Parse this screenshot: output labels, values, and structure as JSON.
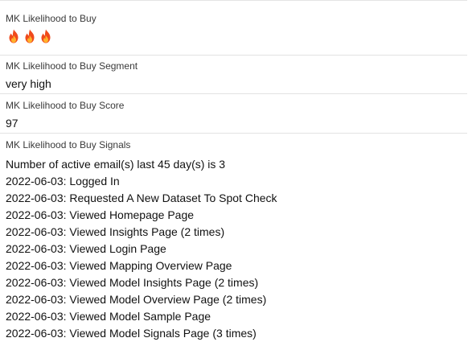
{
  "fields": {
    "likelihood": {
      "label": "MK Likelihood to Buy",
      "icon": "fire-icon",
      "icon_count": 3,
      "icon_color": "#f04a1c"
    },
    "segment": {
      "label": "MK Likelihood to Buy Segment",
      "value": "very high"
    },
    "score": {
      "label": "MK Likelihood to Buy Score",
      "value": "97"
    },
    "signals": {
      "label": "MK Likelihood to Buy Signals",
      "lines": [
        "Number of active email(s) last 45 day(s) is 3",
        "2022-06-03: Logged In",
        "2022-06-03: Requested A New Dataset To Spot Check",
        "2022-06-03: Viewed Homepage Page",
        "2022-06-03: Viewed Insights Page (2 times)",
        "2022-06-03: Viewed Login Page",
        "2022-06-03: Viewed Mapping Overview Page",
        "2022-06-03: Viewed Model Insights Page (2 times)",
        "2022-06-03: Viewed Model Overview Page (2 times)",
        "2022-06-03: Viewed Model Sample Page",
        "2022-06-03: Viewed Model Signals Page (3 times)"
      ]
    }
  }
}
